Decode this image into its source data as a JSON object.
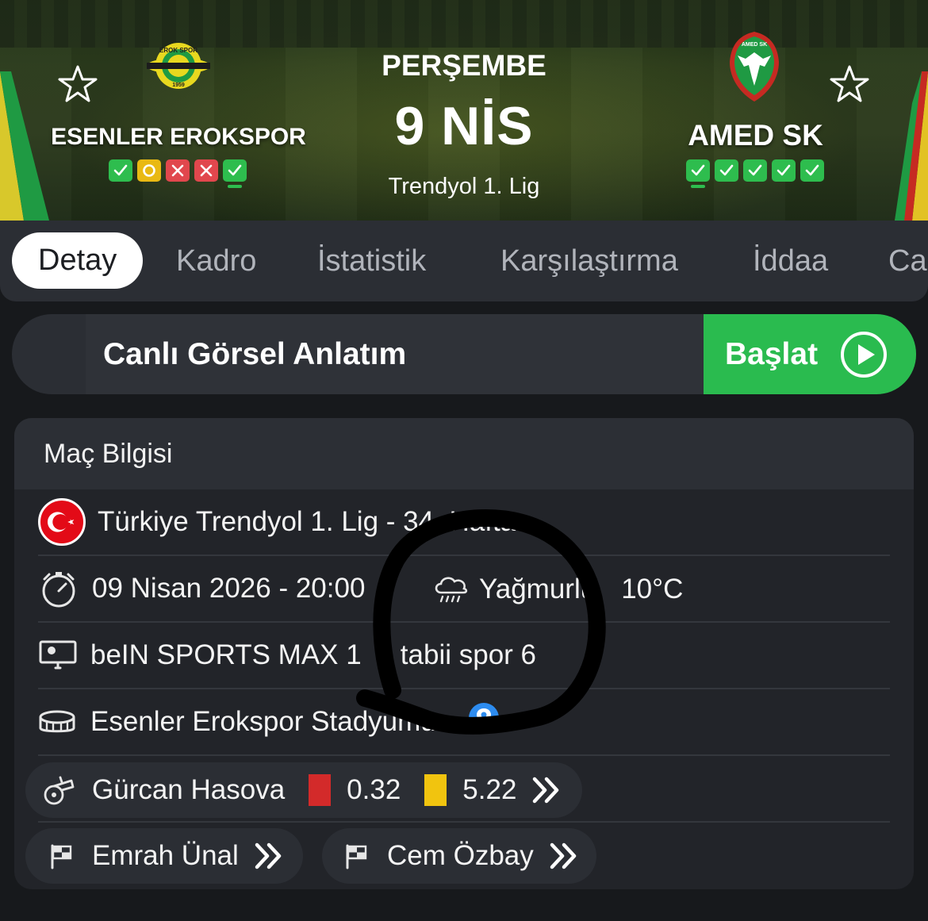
{
  "header": {
    "day": "PERŞEMBE",
    "date": "9 NİS",
    "league": "Trendyol 1. Lig",
    "home": {
      "name": "ESENLER EROKSPOR",
      "crest_text": "EROK SPOR",
      "crest_year": "1959",
      "form": [
        "win",
        "draw",
        "loss",
        "loss",
        "win"
      ]
    },
    "away": {
      "name": "AMED SK",
      "crest_text": "AMED SK",
      "form": [
        "win",
        "win",
        "win",
        "win",
        "win"
      ]
    }
  },
  "tabs": [
    {
      "label": "Detay",
      "active": true
    },
    {
      "label": "Kadro",
      "active": false
    },
    {
      "label": "İstatistik",
      "active": false
    },
    {
      "label": "Karşılaştırma",
      "active": false
    },
    {
      "label": "İddaa",
      "active": false
    },
    {
      "label": "Ca",
      "active": false
    }
  ],
  "live": {
    "label": "Canlı Görsel Anlatım",
    "button_label": "Başlat"
  },
  "match_info": {
    "title": "Maç Bilgisi",
    "competition": "Türkiye Trendyol 1. Lig - 34. Hafta",
    "datetime": "09 Nisan 2026 - 20:00",
    "weather": "Yağmurlu",
    "temperature": "10°C",
    "broadcaster_1": "beIN SPORTS MAX 1",
    "broadcaster_separator": "|",
    "broadcaster_2": "tabii spor 6",
    "stadium": "Esenler Erokspor Stadyumu",
    "referee": {
      "name": "Gürcan Hasova",
      "red_avg": "0.32",
      "yellow_avg": "5.22"
    },
    "assistant_1": "Emrah Ünal",
    "assistant_2": "Cem Özbay"
  },
  "colors": {
    "win": "#2ebd4e",
    "draw": "#e9b913",
    "loss": "#e1474d",
    "accent_green": "#2abb4f",
    "background": "#17191c",
    "card": "#222429"
  },
  "icons": [
    "star-icon",
    "check-icon",
    "circle-icon",
    "cross-icon",
    "play-icon",
    "turkey-flag-icon",
    "clock-icon",
    "rain-icon",
    "tv-icon",
    "stadium-icon",
    "location-pin-icon",
    "whistle-icon",
    "linesman-flag-icon",
    "double-chevron-icon"
  ]
}
